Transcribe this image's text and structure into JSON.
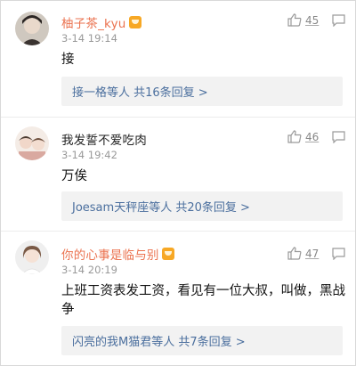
{
  "comments": [
    {
      "user": "柚子茶_kyu",
      "vip": true,
      "time": "3-14 19:14",
      "text": "接",
      "likes": "45",
      "replies": "接一格等人 共16条回复 >"
    },
    {
      "user": "我发誓不爱吃肉",
      "vip": false,
      "time": "3-14 19:42",
      "text": "万俟",
      "likes": "46",
      "replies": "Joesam天秤座等人 共20条回复 >"
    },
    {
      "user": "你的心事是临与别",
      "vip": true,
      "time": "3-14 20:19",
      "text": "上班工资表发工资，看见有一位大叔，叫做，黑战",
      "text2": "争",
      "likes": "47",
      "replies": "闪亮的我M猫君等人 共7条回复 >"
    }
  ],
  "colors": {
    "vip_name": "#eb7350",
    "reply_link": "#4b6f9e",
    "reply_bg": "#f2f2f2",
    "meta": "#999999"
  },
  "icons": [
    "vip-crown-icon",
    "thumbs-up-icon",
    "comment-icon"
  ]
}
